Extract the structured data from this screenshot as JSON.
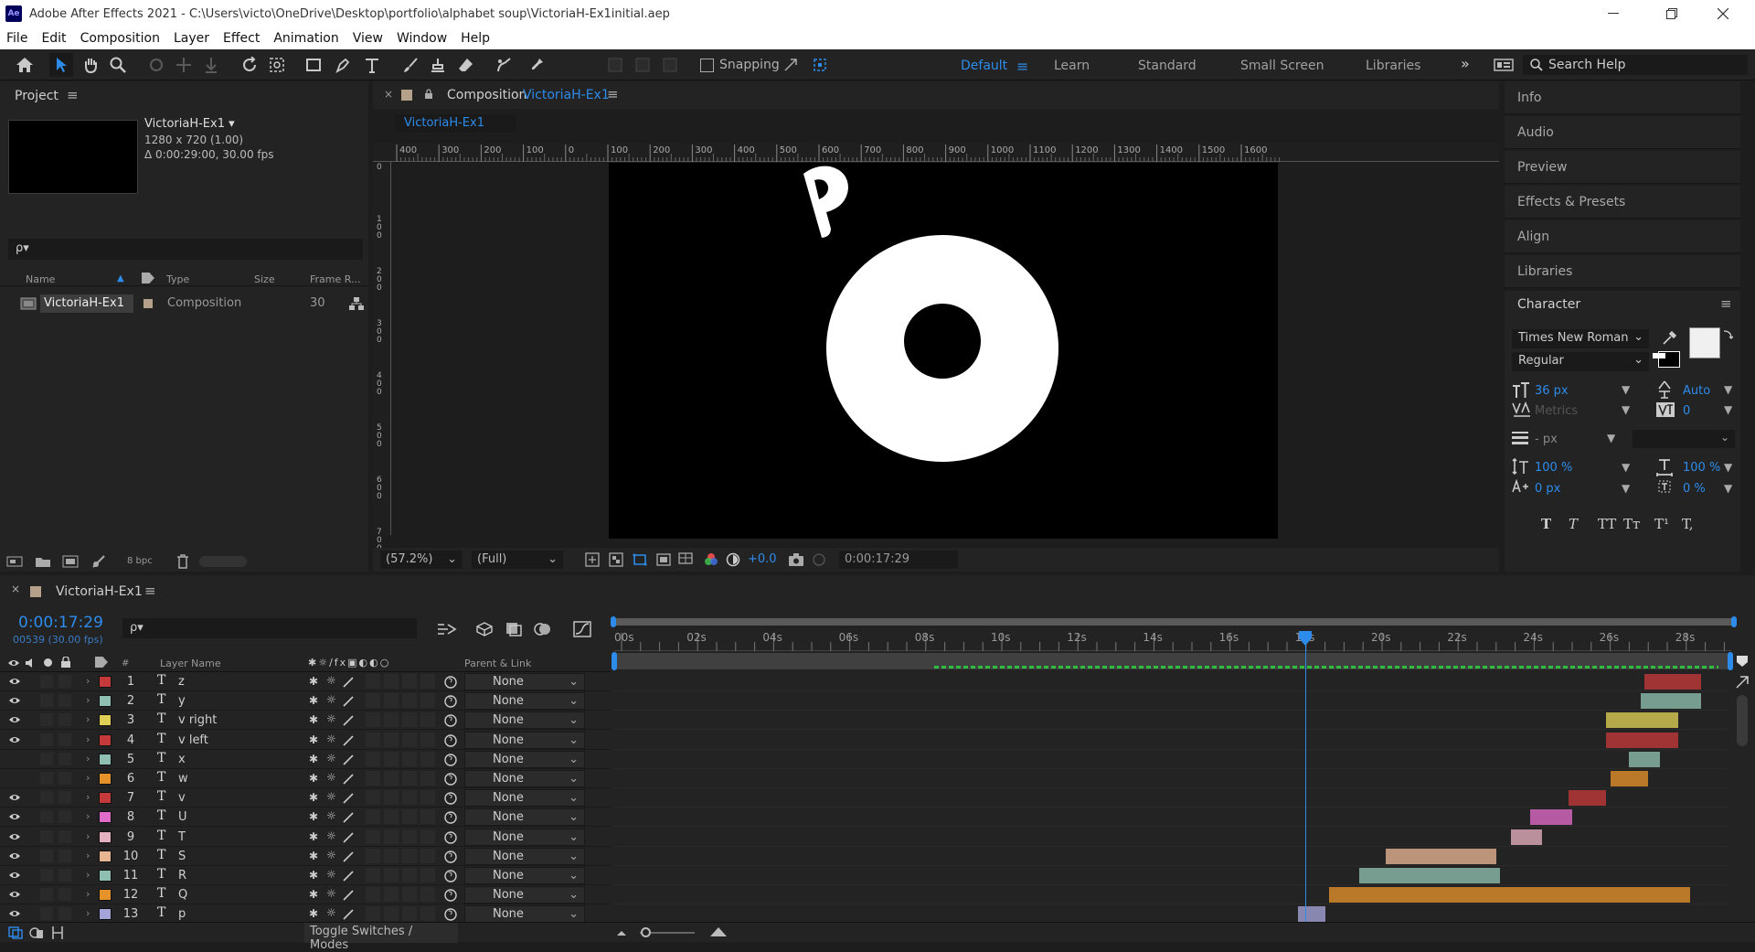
{
  "window": {
    "app_icon": "Ae",
    "title": "Adobe After Effects 2021 - C:\\Users\\victo\\OneDrive\\Desktop\\portfolio\\alphabet soup\\VictoriaH-Ex1initial.aep"
  },
  "menu": [
    "File",
    "Edit",
    "Composition",
    "Layer",
    "Effect",
    "Animation",
    "View",
    "Window",
    "Help"
  ],
  "toolbar": {
    "snapping_label": "Snapping",
    "workspaces": [
      "Default",
      "Learn",
      "Standard",
      "Small Screen",
      "Libraries"
    ],
    "active_workspace": "Default",
    "search_placeholder": "Search Help"
  },
  "project": {
    "tab_label": "Project",
    "comp_name": "VictoriaH-Ex1 ▾",
    "comp_dims": "1280 x 720 (1.00)",
    "comp_duration": "Δ 0:00:29:00, 30.00 fps",
    "search_placeholder": "ρ▾",
    "columns": [
      "Name",
      "Type",
      "Size",
      "Frame R..."
    ],
    "item": {
      "name": "VictoriaH-Ex1",
      "type": "Composition",
      "frame_rate": "30"
    },
    "bpc": "8 bpc"
  },
  "composition": {
    "tab_prefix": "Composition",
    "tab_name": "VictoriaH-Ex1",
    "subtab": "VictoriaH-Ex1",
    "ruler_h": [
      "400",
      "300",
      "200",
      "100",
      "0",
      "100",
      "200",
      "300",
      "400",
      "500",
      "600",
      "700",
      "800",
      "900",
      "1000",
      "1100",
      "1200",
      "1300",
      "1400",
      "1500",
      "1600"
    ],
    "ruler_v": [
      "0",
      "100",
      "200",
      "300",
      "400",
      "500",
      "600",
      "700"
    ],
    "zoom": "(57.2%)",
    "resolution": "(Full)",
    "exposure": "+0.0",
    "timecode": "0:00:17:29"
  },
  "right_panels": [
    "Info",
    "Audio",
    "Preview",
    "Effects & Presets",
    "Align",
    "Libraries"
  ],
  "character": {
    "title": "Character",
    "font": "Times New Roman",
    "style": "Regular",
    "size": "36 px",
    "leading": "Auto",
    "kerning": "Metrics",
    "tracking": "0",
    "line_stroke": "- px",
    "vert_scale": "100 %",
    "horiz_scale": "100 %",
    "baseline": "0 px",
    "tsume": "0 %",
    "style_buttons": [
      "T",
      "T",
      "TT",
      "Tт",
      "T¹",
      "T,"
    ]
  },
  "timeline": {
    "tab_name": "VictoriaH-Ex1",
    "timecode": "0:00:17:29",
    "frames": "00539 (30.00 fps)",
    "search_placeholder": "ρ▾",
    "columns": {
      "layer_name": "Layer Name",
      "parent": "Parent & Link",
      "num": "#"
    },
    "ticks": [
      "00s",
      "02s",
      "04s",
      "06s",
      "08s",
      "10s",
      "12s",
      "14s",
      "16s",
      "18s",
      "20s",
      "22s",
      "24s",
      "26s",
      "28s"
    ],
    "toggle_label": "Toggle Switches / Modes",
    "layers": [
      {
        "num": "1",
        "name": "z",
        "color": "#c43a3a",
        "visible": true,
        "parent": "None",
        "start": 26.9,
        "end": 28.4
      },
      {
        "num": "2",
        "name": "y",
        "color": "#8fbfb0",
        "visible": true,
        "parent": "None",
        "start": 26.8,
        "end": 28.4
      },
      {
        "num": "3",
        "name": "v right",
        "color": "#e0cf55",
        "visible": true,
        "parent": "None",
        "start": 25.9,
        "end": 27.8
      },
      {
        "num": "4",
        "name": "v left",
        "color": "#c43a3a",
        "visible": true,
        "parent": "None",
        "start": 25.9,
        "end": 27.8
      },
      {
        "num": "5",
        "name": "x",
        "color": "#8fbfb0",
        "visible": false,
        "parent": "None",
        "start": 26.5,
        "end": 27.3
      },
      {
        "num": "6",
        "name": "w",
        "color": "#e5922a",
        "visible": false,
        "parent": "None",
        "start": 26.0,
        "end": 27.0
      },
      {
        "num": "7",
        "name": "v",
        "color": "#c43a3a",
        "visible": true,
        "parent": "None",
        "start": 24.9,
        "end": 25.9
      },
      {
        "num": "8",
        "name": "U",
        "color": "#e06bc8",
        "visible": true,
        "parent": "None",
        "start": 23.9,
        "end": 25.0
      },
      {
        "num": "9",
        "name": "T",
        "color": "#e5b0c0",
        "visible": true,
        "parent": "None",
        "start": 23.4,
        "end": 24.2
      },
      {
        "num": "10",
        "name": "S",
        "color": "#e7b592",
        "visible": true,
        "parent": "None",
        "start": 20.1,
        "end": 23.0
      },
      {
        "num": "11",
        "name": "R",
        "color": "#8fbfb0",
        "visible": true,
        "parent": "None",
        "start": 19.4,
        "end": 23.1
      },
      {
        "num": "12",
        "name": "Q",
        "color": "#e5922a",
        "visible": true,
        "parent": "None",
        "start": 18.6,
        "end": 28.1
      },
      {
        "num": "13",
        "name": "p",
        "color": "#a4a4d8",
        "visible": true,
        "parent": "None",
        "start": 17.8,
        "end": 18.5
      }
    ]
  },
  "colors": {
    "accent": "#2d8ceb",
    "workspace_active": "#2d8ceb",
    "panel": "#232323",
    "background": "#1d1d1d"
  }
}
